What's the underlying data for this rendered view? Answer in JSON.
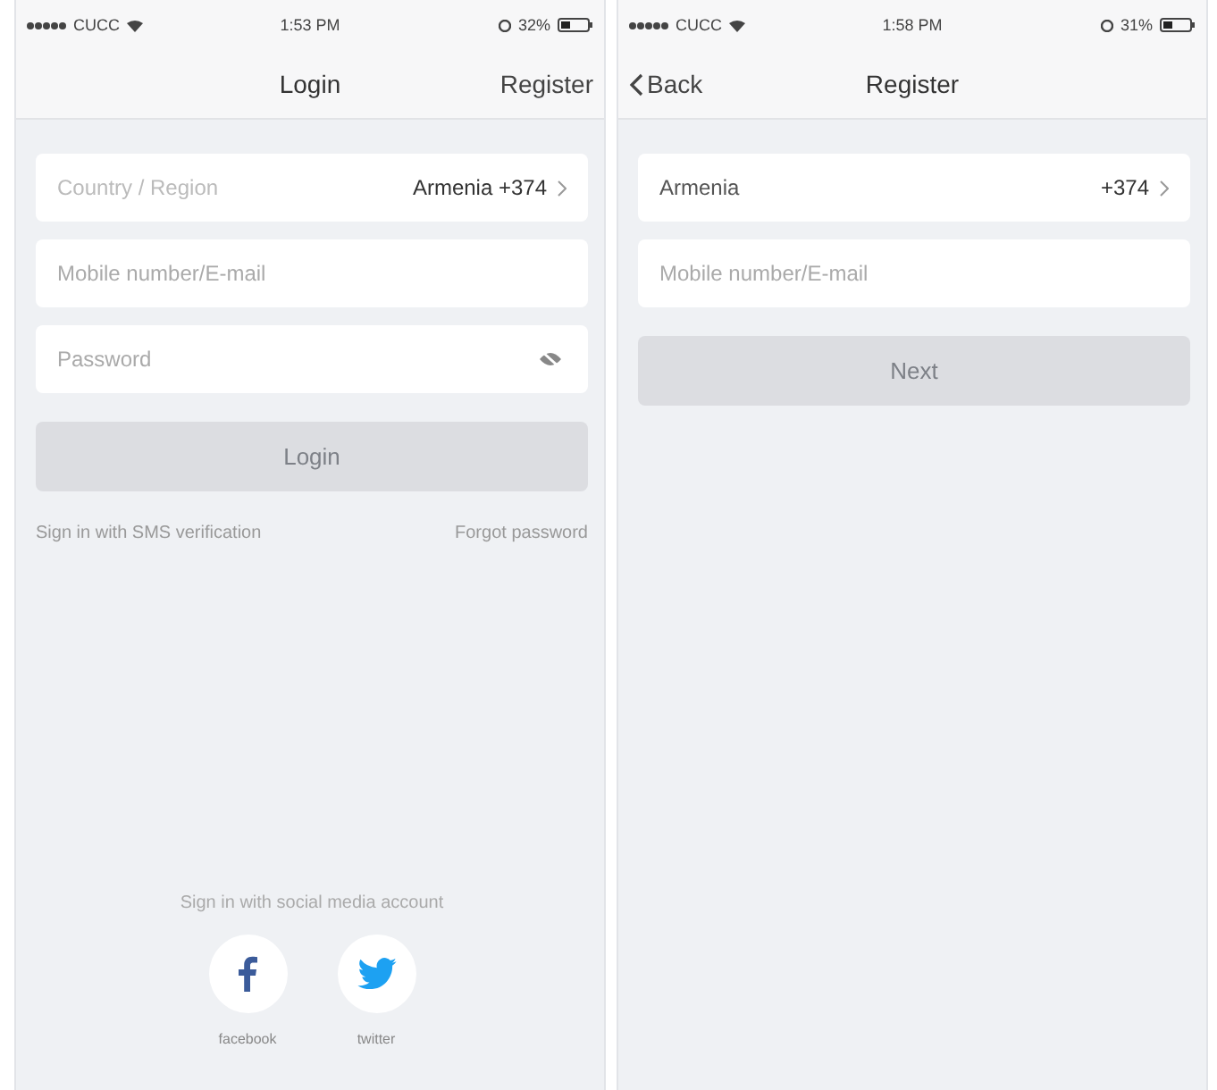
{
  "screens": [
    {
      "status_bar": {
        "carrier": "CUCC",
        "time": "1:53 PM",
        "battery": "32%"
      },
      "nav": {
        "title": "Login",
        "right_action": "Register"
      },
      "fields": [
        {
          "kind": "select",
          "label": "Country / Region",
          "value": "Armenia +374"
        },
        {
          "kind": "text",
          "placeholder": "Mobile number/E-mail"
        },
        {
          "kind": "password",
          "placeholder": "Password"
        }
      ],
      "button": {
        "label": "Login",
        "disabled": true
      },
      "links": [
        "Sign in with SMS verification",
        "Forgot password"
      ],
      "social": {
        "heading": "Sign in with social media account",
        "accounts": [
          {
            "kind": "facebook",
            "label": "facebook"
          },
          {
            "kind": "twitter",
            "label": "twitter"
          }
        ]
      }
    },
    {
      "status_bar": {
        "carrier": "CUCC",
        "time": "1:58 PM",
        "battery": "31%"
      },
      "nav": {
        "back": "Back",
        "title": "Register"
      },
      "fields": [
        {
          "kind": "select",
          "label": "Armenia",
          "value": "+374"
        },
        {
          "kind": "text",
          "placeholder": "Mobile number/E-mail"
        }
      ],
      "button": {
        "label": "Next",
        "disabled": true
      }
    }
  ]
}
